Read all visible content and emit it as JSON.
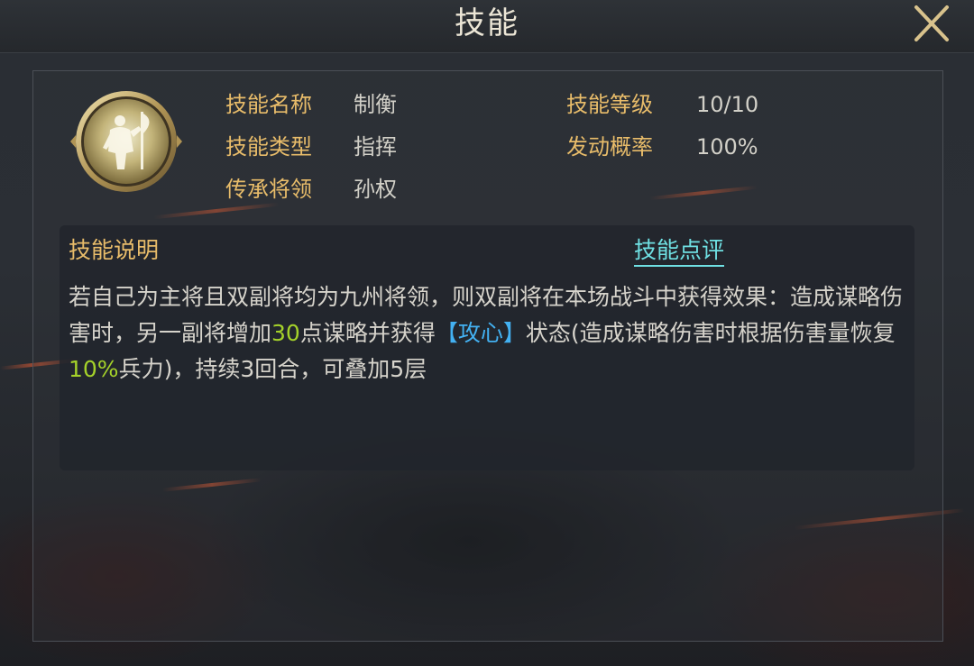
{
  "window": {
    "title": "技能",
    "close_icon": "close-x-icon"
  },
  "skill": {
    "icon": "warrior-portrait-icon",
    "name_label": "技能名称",
    "name_value": "制衡",
    "type_label": "技能类型",
    "type_value": "指挥",
    "inherit_label": "传承将领",
    "inherit_value": "孙权",
    "level_label": "技能等级",
    "level_value": "10/10",
    "trigger_label": "发动概率",
    "trigger_value": "100%"
  },
  "description": {
    "title": "技能说明",
    "review_link": "技能点评",
    "part1": "若自己为主将且双副将均为九州将领，则双副将在本场战斗中获得效果：造成谋略伤害时，另一副将增加",
    "num1": "30",
    "part2": "点谋略并获得",
    "buff": "【攻心】",
    "part3": "状态(造成谋略伤害时根据伤害量恢复",
    "num2": "10%",
    "part4": "兵力)，持续3回合，可叠加5层"
  },
  "colors": {
    "label_gold": "#e8bc6a",
    "value_text": "#d2d0c8",
    "link_cyan": "#6fe0e3",
    "highlight_green": "#a4d12a",
    "highlight_blue": "#43b1f2",
    "title_text": "#ece6d6"
  }
}
